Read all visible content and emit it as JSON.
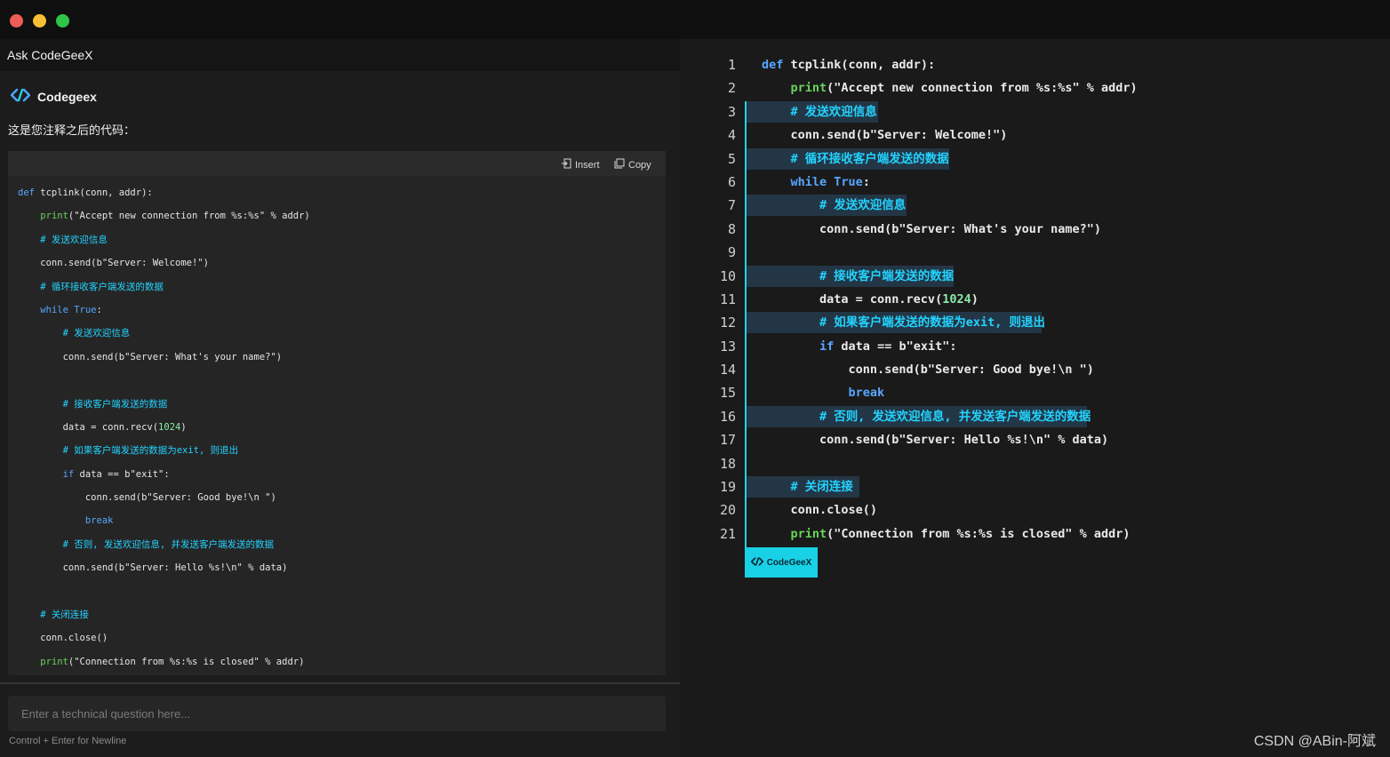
{
  "window": {
    "title": "Ask CodeGeeX"
  },
  "brand": {
    "name": "Codegeex",
    "logo_icon": "codegeex-logo-icon"
  },
  "intro_text": "这是您注释之后的代码：",
  "code_toolbar": {
    "insert_label": "Insert",
    "copy_label": "Copy"
  },
  "input": {
    "placeholder": "Enter a technical question here...",
    "hint": "Control + Enter for Newline"
  },
  "editor": {
    "line_numbers": [
      "1",
      "2",
      "3",
      "4",
      "5",
      "6",
      "7",
      "8",
      "9",
      "10",
      "11",
      "12",
      "13",
      "14",
      "15",
      "16",
      "17",
      "18",
      "19",
      "20",
      "21"
    ],
    "badge_label": "CodeGeeX"
  },
  "colors": {
    "accent": "#1fd3e6",
    "keyword": "#58a6ff",
    "function": "#67d45c",
    "comment": "#23d3ff",
    "background": "#1c1c1c"
  },
  "code_lines": [
    "def tcplink(conn, addr):",
    "    print(\"Accept new connection from %s:%s\" % addr)",
    "    # 发送欢迎信息",
    "    conn.send(b\"Server: Welcome!\")",
    "    # 循环接收客户端发送的数据",
    "    while True:",
    "        # 发送欢迎信息",
    "        conn.send(b\"Server: What's your name?\")",
    "",
    "        # 接收客户端发送的数据",
    "        data = conn.recv(1024)",
    "        # 如果客户端发送的数据为exit, 则退出",
    "        if data == b\"exit\":",
    "            conn.send(b\"Server: Good bye!\\n \")",
    "            break",
    "        # 否则, 发送欢迎信息, 并发送客户端发送的数据",
    "        conn.send(b\"Server: Hello %s!\\n\" % data)",
    "",
    "    # 关闭连接",
    "    conn.close()",
    "    print(\"Connection from %s:%s is closed\" % addr)"
  ],
  "watermark": "CSDN @ABin-阿斌"
}
